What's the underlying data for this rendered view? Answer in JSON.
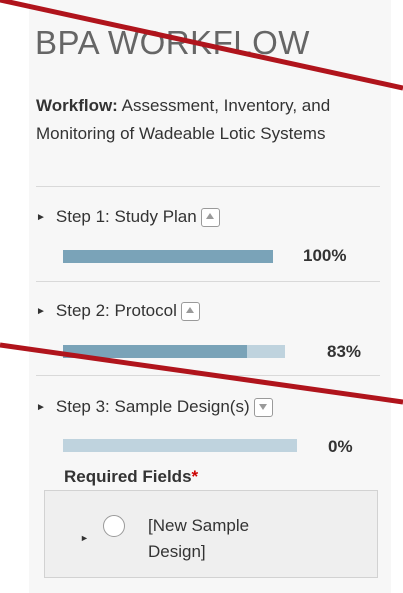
{
  "panel": {
    "title": "BPA WORKFLOW",
    "workflow_label": "Workflow:",
    "workflow_name": " Assessment, Inventory, and Monitoring of Wadeable Lotic Systems"
  },
  "steps": [
    {
      "label": "Step 1: Study Plan",
      "toggle": "collapse",
      "progress": 100,
      "progress_text": "100%"
    },
    {
      "label": "Step 2: Protocol",
      "toggle": "collapse",
      "progress": 83,
      "progress_text": "83%"
    },
    {
      "label": "Step 3: Sample Design(s)",
      "toggle": "expand",
      "progress": 0,
      "progress_text": "0%"
    }
  ],
  "required_fields": {
    "label": "Required Fields",
    "marker": "*"
  },
  "sample_design": {
    "label": "[New Sample Design]"
  },
  "colors": {
    "bar_fill": "#7aa3b8",
    "bar_track": "#bfd3de",
    "annotation_line": "#b0141c",
    "required_marker": "#cc0000"
  },
  "icons": [
    "triangle-right-icon",
    "chevron-up-icon",
    "chevron-down-icon",
    "radio-circle-icon"
  ]
}
